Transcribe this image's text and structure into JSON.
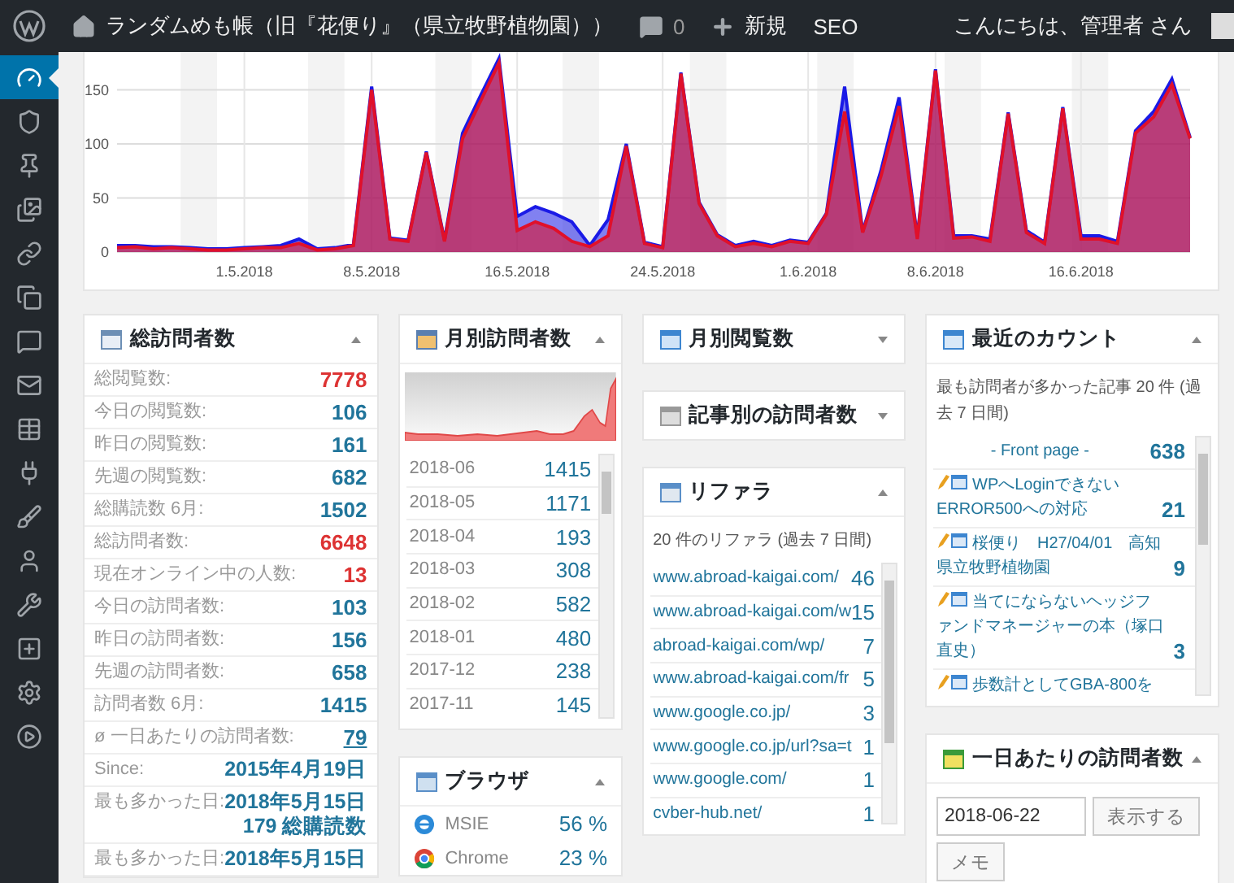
{
  "admin_bar": {
    "site_title": "ランダムめも帳（旧『花便り』（県立牧野植物園））",
    "comments": "0",
    "new_label": "新規",
    "seo_label": "SEO",
    "greeting": "こんにちは、管理者 さん"
  },
  "sidebar": {
    "items": [
      {
        "kind": "dashboard",
        "selected": true
      },
      {
        "kind": "shield",
        "selected": false
      },
      {
        "kind": "pin",
        "selected": false
      },
      {
        "kind": "media",
        "selected": false
      },
      {
        "kind": "link",
        "selected": false
      },
      {
        "kind": "pages",
        "selected": false
      },
      {
        "kind": "comments",
        "selected": false
      },
      {
        "kind": "mail",
        "selected": false
      },
      {
        "kind": "table",
        "selected": false
      },
      {
        "kind": "plugins",
        "selected": false
      },
      {
        "kind": "brush",
        "selected": false
      },
      {
        "kind": "user",
        "selected": false
      },
      {
        "kind": "tools",
        "selected": false
      },
      {
        "kind": "add",
        "selected": false
      },
      {
        "kind": "settings",
        "selected": false
      },
      {
        "kind": "play",
        "selected": false
      }
    ]
  },
  "traffic_chart": {
    "chart_data": {
      "type": "area",
      "categories": [
        null,
        null,
        null,
        null,
        null,
        null,
        null,
        "1.5.2018",
        null,
        null,
        null,
        null,
        null,
        null,
        "8.5.2018",
        null,
        null,
        null,
        null,
        null,
        null,
        null,
        "16.5.2018",
        null,
        null,
        null,
        null,
        null,
        null,
        null,
        "24.5.2018",
        null,
        null,
        null,
        null,
        null,
        null,
        null,
        "1.6.2018",
        null,
        null,
        null,
        null,
        null,
        null,
        "8.6.2018",
        null,
        null,
        null,
        null,
        null,
        null,
        null,
        "16.6.2018",
        null,
        null,
        null,
        null,
        null,
        null
      ],
      "ylim": [
        0,
        185
      ],
      "yticks": [
        0,
        50,
        100,
        150
      ],
      "stacked": false,
      "grid": true,
      "series": [
        {
          "color": "#1a1ae6",
          "values": [
            6,
            6,
            5,
            5,
            4,
            3,
            3,
            4,
            5,
            6,
            12,
            3,
            4,
            7,
            153,
            13,
            11,
            93,
            11,
            110,
            145,
            179,
            33,
            42,
            36,
            28,
            6,
            30,
            100,
            9,
            5,
            166,
            46,
            16,
            6,
            10,
            6,
            11,
            9,
            36,
            153,
            19,
            75,
            143,
            14,
            169,
            15,
            15,
            12,
            129,
            20,
            9,
            134,
            15,
            15,
            10,
            112,
            130,
            160,
            106
          ]
        },
        {
          "color": "#e0102a",
          "values": [
            4,
            5,
            3,
            4,
            3,
            2,
            2,
            3,
            4,
            4,
            8,
            2,
            3,
            6,
            150,
            12,
            10,
            92,
            10,
            105,
            140,
            175,
            20,
            28,
            22,
            10,
            5,
            15,
            98,
            8,
            4,
            165,
            45,
            15,
            5,
            8,
            5,
            10,
            8,
            35,
            130,
            18,
            70,
            135,
            12,
            168,
            13,
            14,
            10,
            128,
            18,
            8,
            133,
            12,
            12,
            8,
            110,
            125,
            155,
            105
          ]
        }
      ]
    }
  },
  "columns": [
    {
      "widgets": [
        {
          "kind": "stats",
          "title": "総訪問者数",
          "expanded": true,
          "rows": [
            {
              "kind": "count",
              "label": "総閲覧数:",
              "value": "7778",
              "color": "#dd3333"
            },
            {
              "kind": "count",
              "label": "今日の閲覧数:",
              "value": "106",
              "color": "#21759b"
            },
            {
              "kind": "count",
              "label": "昨日の閲覧数:",
              "value": "161",
              "color": "#21759b"
            },
            {
              "kind": "count",
              "label": "先週の閲覧数:",
              "value": "682",
              "color": "#21759b"
            },
            {
              "kind": "count",
              "label": "総購読数 6月:",
              "value": "1502",
              "color": "#21759b"
            },
            {
              "kind": "count",
              "label": "総訪問者数:",
              "value": "6648",
              "color": "#dd3333"
            },
            {
              "kind": "count",
              "label": "現在オンライン中の人数:",
              "value": "13",
              "color": "#dd3333"
            },
            {
              "kind": "count",
              "label": "今日の訪問者数:",
              "value": "103",
              "color": "#21759b"
            },
            {
              "kind": "count",
              "label": "昨日の訪問者数:",
              "value": "156",
              "color": "#21759b"
            },
            {
              "kind": "count",
              "label": "先週の訪問者数:",
              "value": "658",
              "color": "#21759b"
            },
            {
              "kind": "count",
              "label": "訪問者数 6月:",
              "value": "1415",
              "color": "#21759b"
            },
            {
              "kind": "link",
              "label": "ø 一日あたりの訪問者数:",
              "value": "79"
            },
            {
              "kind": "date",
              "label": "Since:",
              "value": "2015年4月19日"
            },
            {
              "kind": "date",
              "label": "最も多かった日:",
              "value": "2018年5月15日",
              "note": "179 総購読数"
            },
            {
              "kind": "date",
              "label": "最も多かった日:",
              "value": "2018年5月15日"
            }
          ]
        }
      ]
    },
    {
      "widgets": [
        {
          "kind": "monthly",
          "title": "月別訪問者数",
          "expanded": true,
          "months": [
            {
              "month": "2018-06",
              "value": "1415"
            },
            {
              "month": "2018-05",
              "value": "1171"
            },
            {
              "month": "2018-04",
              "value": "193"
            },
            {
              "month": "2018-03",
              "value": "308"
            },
            {
              "month": "2018-02",
              "value": "582"
            },
            {
              "month": "2018-01",
              "value": "480"
            },
            {
              "month": "2017-12",
              "value": "238"
            },
            {
              "month": "2017-11",
              "value": "145"
            }
          ]
        },
        {
          "kind": "browsers",
          "title": "ブラウザ",
          "expanded": true,
          "browsers": [
            {
              "kind": "ie",
              "name": "MSIE",
              "share": "56 %"
            },
            {
              "kind": "chrome",
              "name": "Chrome",
              "share": "23 %"
            }
          ]
        }
      ]
    },
    {
      "widgets": [
        {
          "kind": "views",
          "title": "月別閲覧数",
          "expanded": false
        },
        {
          "kind": "posts",
          "title": "記事別の訪問者数",
          "expanded": false
        },
        {
          "kind": "referrers",
          "title": "リファラ",
          "expanded": true,
          "summary": "20 件のリファラ (過去 7 日間)",
          "items": [
            {
              "url": "www.abroad-kaigai.com/",
              "count": "46"
            },
            {
              "url": "www.abroad-kaigai.com/w",
              "count": "15"
            },
            {
              "url": "abroad-kaigai.com/wp/",
              "count": "7"
            },
            {
              "url": "www.abroad-kaigai.com/fr",
              "count": "5"
            },
            {
              "url": "www.google.co.jp/",
              "count": "3"
            },
            {
              "url": "www.google.co.jp/url?sa=t",
              "count": "1"
            },
            {
              "url": "www.google.com/",
              "count": "1"
            },
            {
              "url": "cvber-hub.net/",
              "count": "1"
            }
          ]
        }
      ]
    },
    {
      "widgets": [
        {
          "kind": "recent",
          "title": "最近のカウント",
          "expanded": true,
          "summary": "最も訪問者が多かった記事 20 件 (過去 7 日間)",
          "items": [
            {
              "kind": "front",
              "title": "- Front page -",
              "count": "638"
            },
            {
              "kind": "post",
              "title": "WPへLoginできない ERROR500への対応",
              "count": "21"
            },
            {
              "kind": "post",
              "title": "桜便り　H27/04/01　高知県立牧野植物園",
              "count": "9"
            },
            {
              "kind": "post",
              "title": "当てにならないヘッジファンドマネージャーの本（塚口直史）",
              "count": "3"
            },
            {
              "kind": "post",
              "title": "歩数計としてGBA-800を"
            }
          ]
        },
        {
          "kind": "daily",
          "title": "一日あたりの訪問者数",
          "expanded": true,
          "date_value": "2018-06-22",
          "show_button": "表示する",
          "memo_button": "メモ"
        }
      ]
    }
  ]
}
